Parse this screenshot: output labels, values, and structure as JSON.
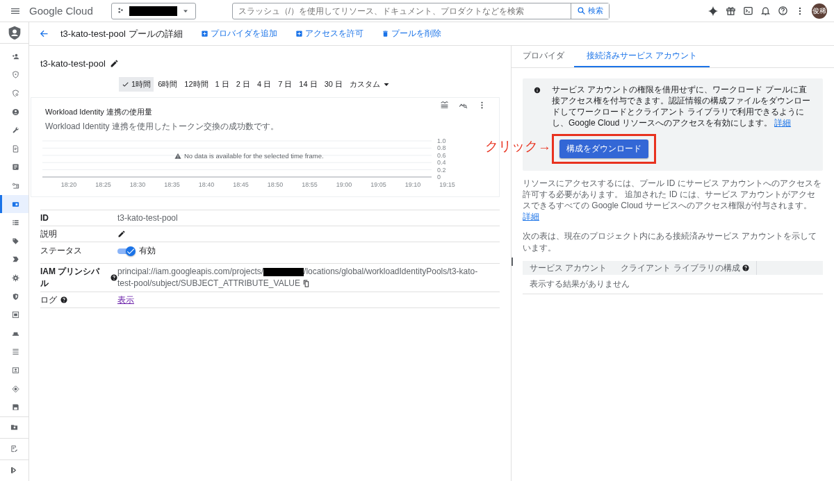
{
  "topbar": {
    "logo": "Google Cloud",
    "search": {
      "placeholder": "スラッシュ（/）を使用してリソース、ドキュメント、プロダクトなどを検索",
      "button": "検索"
    },
    "avatar": "俊稀"
  },
  "sidebar": {
    "items": [
      {
        "selected": false
      },
      {
        "selected": false
      },
      {
        "selected": false
      },
      {
        "selected": false
      },
      {
        "selected": false
      },
      {
        "selected": false
      },
      {
        "selected": false
      },
      {
        "selected": false
      },
      {
        "selected": true
      },
      {
        "selected": false
      },
      {
        "selected": false
      },
      {
        "selected": false
      },
      {
        "selected": false
      },
      {
        "selected": false
      },
      {
        "selected": false
      },
      {
        "selected": false
      },
      {
        "selected": false
      },
      {
        "selected": false
      },
      {
        "selected": false
      },
      {
        "selected": false
      }
    ]
  },
  "header": {
    "title": "t3-kato-test-pool プールの詳細",
    "actions": [
      {
        "kind": "add",
        "label": "プロバイダを追加"
      },
      {
        "kind": "add",
        "label": "アクセスを許可"
      },
      {
        "kind": "delete",
        "label": "プールを削除"
      }
    ]
  },
  "pool_name": "t3-kato-test-pool",
  "time_ranges": [
    {
      "label": "1時間",
      "selected": true
    },
    {
      "label": "6時間",
      "selected": false
    },
    {
      "label": "12時間",
      "selected": false
    },
    {
      "label": "1 日",
      "selected": false
    },
    {
      "label": "2 日",
      "selected": false
    },
    {
      "label": "4 日",
      "selected": false
    },
    {
      "label": "7 日",
      "selected": false
    },
    {
      "label": "14 日",
      "selected": false
    },
    {
      "label": "30 日",
      "selected": false
    },
    {
      "label": "カスタム",
      "selected": false
    }
  ],
  "chart": {
    "title": "Workload Identity 連携の使用量",
    "subtitle": "Workload Identity 連携を使用したトークン交換の成功数です。",
    "message": "No data is available for the selected time frame.",
    "chart_data": {
      "type": "line",
      "grid": true,
      "categories": [
        "18:20",
        "18:25",
        "18:30",
        "18:35",
        "18:40",
        "18:45",
        "18:50",
        "18:55",
        "19:00",
        "19:05",
        "19:10",
        "19:15"
      ],
      "ylim": [
        0,
        1
      ],
      "yticks": [
        {
          "value": 0,
          "label": "0"
        },
        {
          "value": 0.2,
          "label": "0.2"
        },
        {
          "value": 0.4,
          "label": "0.4"
        },
        {
          "value": 0.6,
          "label": "0.6"
        },
        {
          "value": 0.8,
          "label": "0.8"
        },
        {
          "value": 1,
          "label": "1.0"
        }
      ]
    }
  },
  "details": [
    {
      "kind": "text",
      "label": "ID",
      "value": "t3-kato-test-pool"
    },
    {
      "kind": "edit",
      "label": "説明"
    },
    {
      "kind": "toggle",
      "label": "ステータス",
      "on": true,
      "value": "有効"
    },
    {
      "kind": "principal",
      "label": "IAM プリンシパル",
      "value_before": "principal://iam.googleapis.com/projects/",
      "value_after": "/locations/global/workloadIdentityPools/t3-kato-test-pool/subject/SUBJECT_ATTRIBUTE_VALUE"
    },
    {
      "kind": "link",
      "label": "ログ",
      "value": "表示"
    }
  ],
  "right": {
    "tabs": [
      {
        "label": "プロバイダ",
        "selected": false
      },
      {
        "label": "接続済みサービス アカウント",
        "selected": true
      }
    ],
    "info": {
      "text": "サービス アカウントの権限を借用せずに、ワークロード プールに直接アクセス権を付与できます。認証情報の構成ファイルをダウンロードしてワークロードとクライアント ライブラリで利用できるようにし、Google Cloud リソースへのアクセスを有効にします。",
      "link": "詳細",
      "button": "構成をダウンロード"
    },
    "annotation": "クリック→",
    "paragraph": "リソースにアクセスするには、プール ID にサービス アカウントへのアクセスを許可する必要があります。 追加された ID には、サービス アカウントがアクセスできるすべての Google Cloud サービスへのアクセス権限が付与されます。",
    "paragraph_link": "詳細",
    "table_intro": "次の表は、現在のプロジェクト内にある接続済みサービス アカウントを示しています。",
    "table": {
      "columns": [
        "サービス アカウント",
        "クライアント ライブラリの構成"
      ],
      "empty": "表示する結果がありません"
    }
  }
}
